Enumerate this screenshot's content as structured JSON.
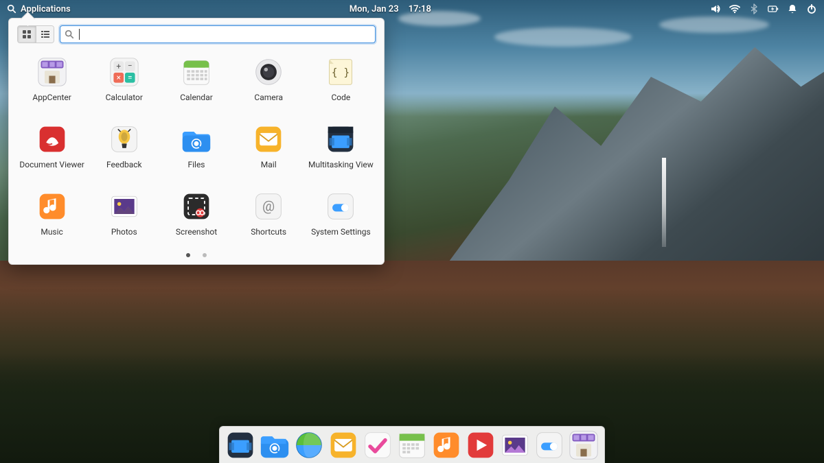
{
  "panel": {
    "applications_label": "Applications",
    "date": "Mon, Jan 23",
    "time": "17:18",
    "tray": [
      "volume-icon",
      "wifi-icon",
      "bluetooth-icon",
      "battery-icon",
      "bell-icon",
      "power-icon"
    ]
  },
  "launcher": {
    "view": "grid",
    "search_placeholder": "",
    "search_value": "",
    "pages": {
      "total": 2,
      "active": 0
    },
    "apps": [
      {
        "id": "appcenter",
        "label": "AppCenter"
      },
      {
        "id": "calculator",
        "label": "Calculator"
      },
      {
        "id": "calendar",
        "label": "Calendar"
      },
      {
        "id": "camera",
        "label": "Camera"
      },
      {
        "id": "code",
        "label": "Code"
      },
      {
        "id": "documentviewer",
        "label": "Document Viewer"
      },
      {
        "id": "feedback",
        "label": "Feedback"
      },
      {
        "id": "files",
        "label": "Files"
      },
      {
        "id": "mail",
        "label": "Mail"
      },
      {
        "id": "multitasking",
        "label": "Multitasking View"
      },
      {
        "id": "music",
        "label": "Music"
      },
      {
        "id": "photos",
        "label": "Photos"
      },
      {
        "id": "screenshot",
        "label": "Screenshot"
      },
      {
        "id": "shortcuts",
        "label": "Shortcuts"
      },
      {
        "id": "settings",
        "label": "System Settings"
      }
    ]
  },
  "dock": {
    "items": [
      {
        "id": "multitasking",
        "label": "Multitasking View"
      },
      {
        "id": "files",
        "label": "Files"
      },
      {
        "id": "web",
        "label": "Web"
      },
      {
        "id": "mail",
        "label": "Mail"
      },
      {
        "id": "tasks",
        "label": "Tasks"
      },
      {
        "id": "calendar",
        "label": "Calendar"
      },
      {
        "id": "music",
        "label": "Music"
      },
      {
        "id": "videos",
        "label": "Videos"
      },
      {
        "id": "photos",
        "label": "Photos"
      },
      {
        "id": "settings",
        "label": "System Settings"
      },
      {
        "id": "appcenter",
        "label": "AppCenter"
      }
    ]
  }
}
